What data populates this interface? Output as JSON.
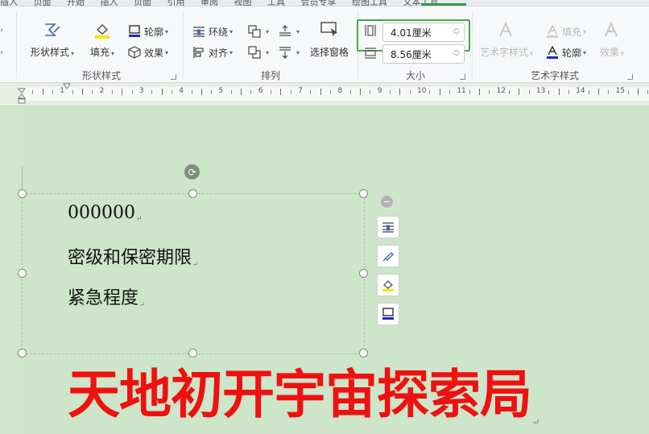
{
  "menu": {
    "tabs": [
      "插入",
      "页面",
      "开始",
      "插入",
      "页面",
      "引用",
      "审阅",
      "视图",
      "工具",
      "会员专享",
      "绘图工具",
      "文本工具"
    ]
  },
  "ribbon": {
    "shape_style_group": {
      "label": "形状样式",
      "shape_style_button": "形状样式",
      "fill_button": "填充",
      "outline_button": "轮廓",
      "effect_button": "效果"
    },
    "arrange_group": {
      "label": "排列",
      "wrap_button": "环绕",
      "align_button": "对齐",
      "selection_pane_button": "选择窗格"
    },
    "size_group": {
      "label": "大小",
      "height_value": "4.01厘米",
      "width_value": "8.56厘米"
    },
    "wordart_group": {
      "label": "艺术字样式",
      "wordart_style_button": "艺术字样式",
      "text_fill_button": "填充",
      "text_outline_button": "轮廓",
      "text_effect_button": "效果"
    }
  },
  "ruler": {
    "numbers": [
      "1",
      "2",
      "3",
      "4",
      "5",
      "6",
      "7",
      "8",
      "9",
      "10",
      "11",
      "12",
      "13",
      "14",
      "15"
    ]
  },
  "document": {
    "lines": [
      "000000",
      "密级和保密期限",
      "紧急程度"
    ],
    "headline": "天地初开宇宙探索局"
  },
  "colors": {
    "accent_green": "#45a84b",
    "headline_red": "#f01010",
    "page_bg": "#cde5c9"
  }
}
